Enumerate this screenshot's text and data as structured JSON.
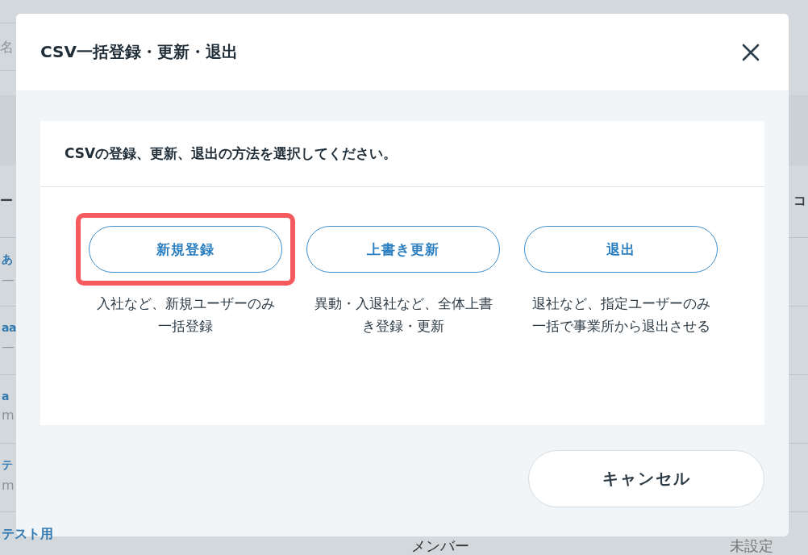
{
  "background": {
    "search_placeholder": "名",
    "header": {
      "column_1": "ー",
      "column_3": "コ"
    },
    "rows": [
      {
        "name": "あ",
        "sub": "—"
      },
      {
        "name": "aa",
        "sub": "—"
      },
      {
        "name": "a",
        "sub": "m"
      },
      {
        "name": "テ",
        "sub": "m"
      },
      {
        "name": "テスト用",
        "role": "メンバー",
        "status": "未設定"
      }
    ]
  },
  "dialog": {
    "title": "CSV一括登録・更新・退出",
    "instruction": "CSVの登録、更新、退出の方法を選択してください。",
    "options": [
      {
        "label": "新規登録",
        "description": "入社など、新規ユーザーのみ一括登録",
        "highlighted": true
      },
      {
        "label": "上書き更新",
        "description": "異動・入退社など、全体上書き登録・更新",
        "highlighted": false
      },
      {
        "label": "退出",
        "description": "退社など、指定ユーザーのみ一括で事業所から退出させる",
        "highlighted": false
      }
    ],
    "cancel_button": "キャンセル"
  }
}
